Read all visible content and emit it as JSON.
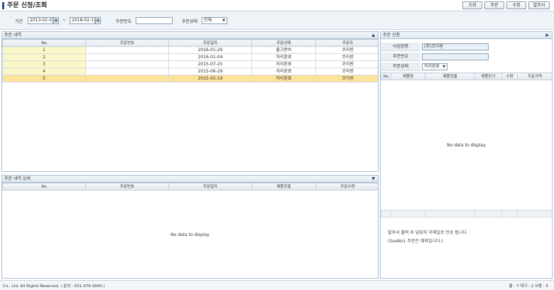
{
  "header": {
    "title": "주문 신청/조회",
    "buttons": [
      "조회",
      "주문",
      "수정",
      "발주서"
    ]
  },
  "search": {
    "period_label": "기간",
    "date_from": "2013-02-01",
    "tilde": "~",
    "date_to": "2018-02-11",
    "order_no_label": "주문번호",
    "order_no_value": "",
    "status_label": "주문상태",
    "status_value": "전체"
  },
  "order_list": {
    "title": "주문 내역",
    "columns": [
      "No",
      "주문번호",
      "주문일자",
      "주문상태",
      "주문자"
    ],
    "rows": [
      {
        "no": "1",
        "order_no": "",
        "date": "2016-01-29",
        "status": "출고준비",
        "orderer": "코리센"
      },
      {
        "no": "2",
        "order_no": "",
        "date": "2016-01-04",
        "status": "처리완료",
        "orderer": "코리센"
      },
      {
        "no": "3",
        "order_no": "",
        "date": "2015-07-25",
        "status": "처리완료",
        "orderer": "코리센"
      },
      {
        "no": "4",
        "order_no": "",
        "date": "2015-06-29",
        "status": "처리완료",
        "orderer": "코리센"
      },
      {
        "no": "5",
        "order_no": "",
        "date": "2015-05-19",
        "status": "처리완료",
        "orderer": "코리센"
      }
    ]
  },
  "order_detail": {
    "title": "주문 내역 상세",
    "columns": [
      "No",
      "주문번호",
      "주문일자",
      "제품모델",
      "주문수량"
    ],
    "empty_text": "No data to display"
  },
  "order_request": {
    "title": "주문 신청",
    "business_label": "사업장명",
    "business_value": "(주)코리센",
    "order_no_label": "주문번호",
    "order_no_value": "",
    "status_label": "주문상태",
    "status_value": "처리완료",
    "columns": [
      "No",
      "제품명",
      "제품모델",
      "제품단가",
      "수량",
      "주문가격"
    ],
    "empty_text": "No data to display",
    "note_line1": "발주서 출력 후 담당자 이메일로 전송 됩니다.",
    "note_line2": "(SeaNo1 주문은 제외입니다.)"
  },
  "footer": {
    "copyright": "Co., Ltd. All Rights Reserved. ( 문의 : 031-379-3000 )",
    "status": "총 : 7  대기 : 2  사용 : 5"
  },
  "colors": {
    "accent": "#1f4f8f",
    "selected_row": "#fde39a",
    "no_column": "#fbf7c8",
    "panel_border": "#a9bccf"
  }
}
